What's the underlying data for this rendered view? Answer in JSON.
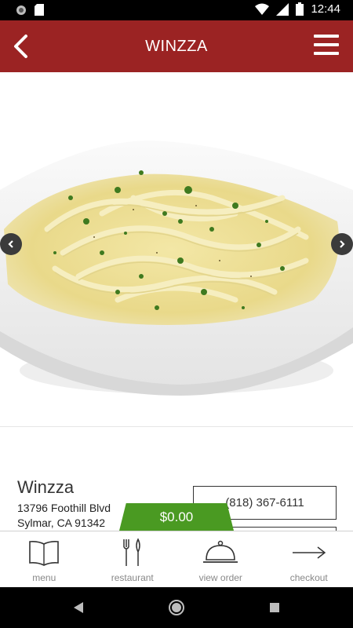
{
  "status_bar": {
    "time": "12:44"
  },
  "header": {
    "title": "WINZZA"
  },
  "hero": {
    "image": "fettuccine-alfredo-photo"
  },
  "restaurant": {
    "name": "Winzza",
    "address_line1": "13796 Foothill Blvd",
    "address_line2": "Sylmar, CA 91342",
    "phone": "(818) 367-6111"
  },
  "order": {
    "total": "$0.00"
  },
  "tabs": [
    {
      "label": "menu",
      "icon": "book-icon"
    },
    {
      "label": "restaurant",
      "icon": "fork-knife-icon"
    },
    {
      "label": "view order",
      "icon": "cloche-icon"
    },
    {
      "label": "checkout",
      "icon": "arrow-right-icon"
    }
  ],
  "colors": {
    "header": "#9b2323",
    "total_tab": "#4a9a22"
  }
}
